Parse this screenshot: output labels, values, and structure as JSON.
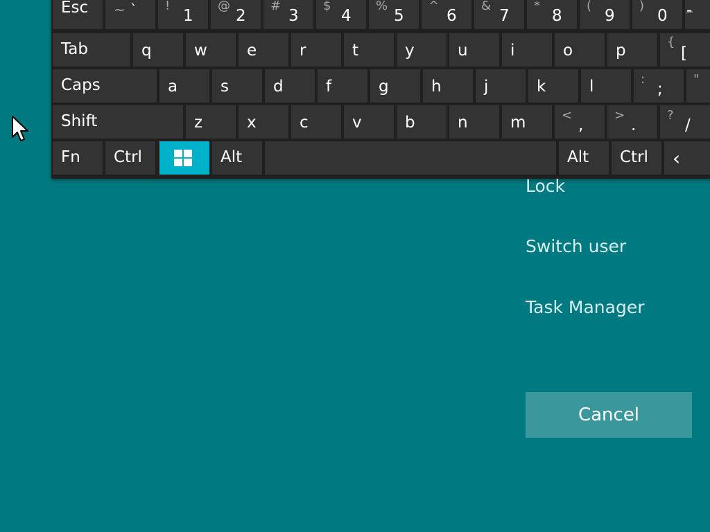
{
  "keyboard": {
    "row0": [
      {
        "label": "Esc"
      },
      {
        "shift": "~",
        "base": "`"
      },
      {
        "shift": "!",
        "base": "1"
      },
      {
        "shift": "@",
        "base": "2"
      },
      {
        "shift": "#",
        "base": "3"
      },
      {
        "shift": "$",
        "base": "4"
      },
      {
        "shift": "%",
        "base": "5"
      },
      {
        "shift": "^",
        "base": "6"
      },
      {
        "shift": "&",
        "base": "7"
      },
      {
        "shift": "*",
        "base": "8"
      },
      {
        "shift": "(",
        "base": "9"
      },
      {
        "shift": ")",
        "base": "0"
      },
      {
        "shift": "_",
        "base": "-"
      }
    ],
    "row1": [
      "Tab",
      "q",
      "w",
      "e",
      "r",
      "t",
      "y",
      "u",
      "i",
      "o",
      "p"
    ],
    "row1_bracket": {
      "shift": "{",
      "base": "["
    },
    "row2": [
      "Caps",
      "a",
      "s",
      "d",
      "f",
      "g",
      "h",
      "j",
      "k",
      "l"
    ],
    "row2_semicolon": {
      "shift": ":",
      "base": ";"
    },
    "row2_quote": {
      "shift": "\"",
      "base": "'"
    },
    "row3": [
      "Shift",
      "z",
      "x",
      "c",
      "v",
      "b",
      "n",
      "m"
    ],
    "row3_comma": {
      "shift": "<",
      "base": ","
    },
    "row3_period": {
      "shift": ">",
      "base": "."
    },
    "row3_slash": {
      "shift": "?",
      "base": "/"
    },
    "row4": {
      "fn": "Fn",
      "ctrl_left": "Ctrl",
      "alt_left": "Alt",
      "alt_right": "Alt",
      "ctrl_right": "Ctrl"
    },
    "win_key_color": "#00b2c9",
    "key_color": "#333333"
  },
  "menu": {
    "items": [
      "Lock",
      "Switch user",
      "Task Manager"
    ],
    "cancel_label": "Cancel"
  },
  "colors": {
    "background": "#007a80",
    "cancel_button": "#3a989d"
  }
}
